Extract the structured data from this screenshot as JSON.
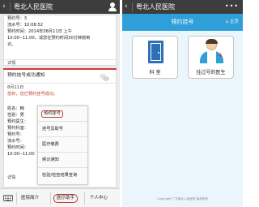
{
  "left_phone": {
    "header": {
      "back_glyph": "‹",
      "title": "粤北人民医院",
      "icon": "person-icon"
    },
    "card1": {
      "lines": [
        "预约号：3",
        "流水号：10:08:52",
        "预约时间：2014年08月11日 上午",
        "10:00--11:00，请您在预约时间30分钟前到",
        "诊。"
      ],
      "detail": "详情"
    },
    "card2": {
      "title": "预约挂号成功通知",
      "date": "8月11日",
      "greeting": "您好，您已预约挂号成功。",
      "fields": [
        "姓名：韩",
        "性别：男",
        "预约医生：",
        "预约科室：",
        "预约号：",
        "流水号：",
        "预约时间：",
        "10:00--11:00"
      ],
      "detail": "详情"
    },
    "popup_menu": [
      "预约挂号",
      "挂号及取号",
      "医疗缴费",
      "候诊通知",
      "检验/检查结果查询"
    ],
    "bottom_tabs": [
      "医院简介",
      "医疗助手",
      "个人中心"
    ],
    "active_tab": "医疗助手"
  },
  "right_phone": {
    "header": {
      "back_glyph": "‹",
      "title": "粤北人民医院",
      "more": "•••"
    },
    "section_title": "预约挂号",
    "home_link": "⌂ 主页",
    "tiles": [
      {
        "label": "科 室",
        "icon": "door-icon"
      },
      {
        "label": "挂过号的医生",
        "icon": "doctor-icon"
      }
    ],
    "footer": "Copyright 广东粤北人民医院 版权所有"
  },
  "colors": {
    "header_bg": "#3d3d3d",
    "accent_red": "#d63a3a",
    "accent_blue": "#2e9fd8",
    "right_bg": "#eaf6fb"
  }
}
